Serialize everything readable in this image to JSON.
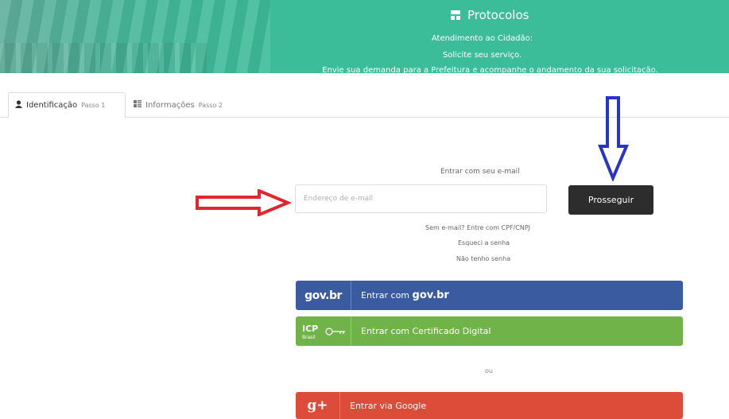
{
  "banner": {
    "title": "Protocolos",
    "line1": "Atendimento ao Cidadão:",
    "line2": "Solicite seu serviço.",
    "line3": "Envie sua demanda para a Prefeitura e acompanhe o andamento da sua solicitação."
  },
  "tabs": [
    {
      "label": "Identificação",
      "step": "Passo 1",
      "icon": "user-icon"
    },
    {
      "label": "Informações",
      "step": "Passo 2",
      "icon": "grid-icon"
    }
  ],
  "form": {
    "email_caption": "Entrar com seu e-mail",
    "email_placeholder": "Endereço de e-mail",
    "submit_label": "Prosseguir",
    "link_cpf": "Sem e-mail? Entre com CPF/CNPJ",
    "link_forgot": "Esqueci a senha",
    "link_no_password": "Não tenho senha"
  },
  "login_options": {
    "govbr_logo": "gov.br",
    "govbr_prefix": "Entrar com",
    "govbr_brand": "gov.br",
    "cert_logo": "ICP Brasil",
    "cert_label": "Entrar com Certificado Digital",
    "separator": "ou",
    "google_logo": "g+",
    "google_label": "Entrar via Google"
  },
  "colors": {
    "banner": "#3bbd99",
    "govbr": "#3a5ba0",
    "cert": "#6fb349",
    "google": "#dd4b39",
    "submit": "#2d2d2d",
    "arrow_red": "#e0262e",
    "arrow_blue": "#2933c8"
  }
}
